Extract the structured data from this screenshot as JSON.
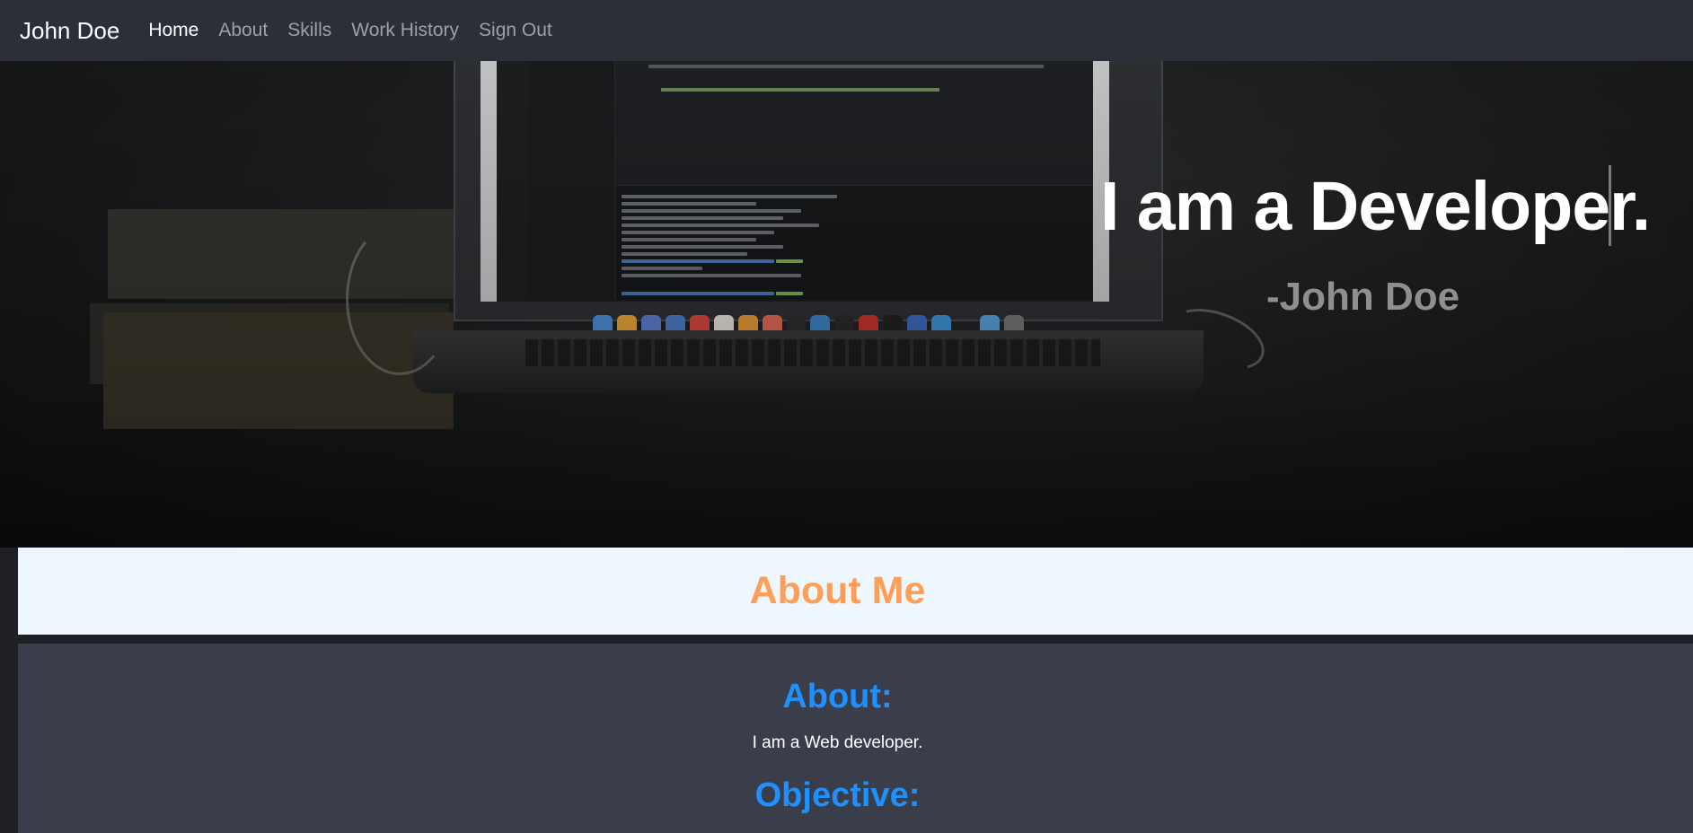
{
  "navbar": {
    "brand": "John Doe",
    "links": [
      "Home",
      "About",
      "Skills",
      "Work History",
      "Sign Out"
    ],
    "active": "Home"
  },
  "hero": {
    "title": "I am a Developer.",
    "subtitle": "-John Doe"
  },
  "about_banner": {
    "title": "About Me"
  },
  "about_section": {
    "about_heading": "About:",
    "about_text": "I am a Web developer.",
    "objective_heading": "Objective:"
  },
  "colors": {
    "navbar_bg": "#2b2f38",
    "banner_bg": "#eef7fd",
    "banner_title": "#ff9f57",
    "heading_blue": "#1e90ff",
    "section_bg": "#3a3e4b"
  }
}
